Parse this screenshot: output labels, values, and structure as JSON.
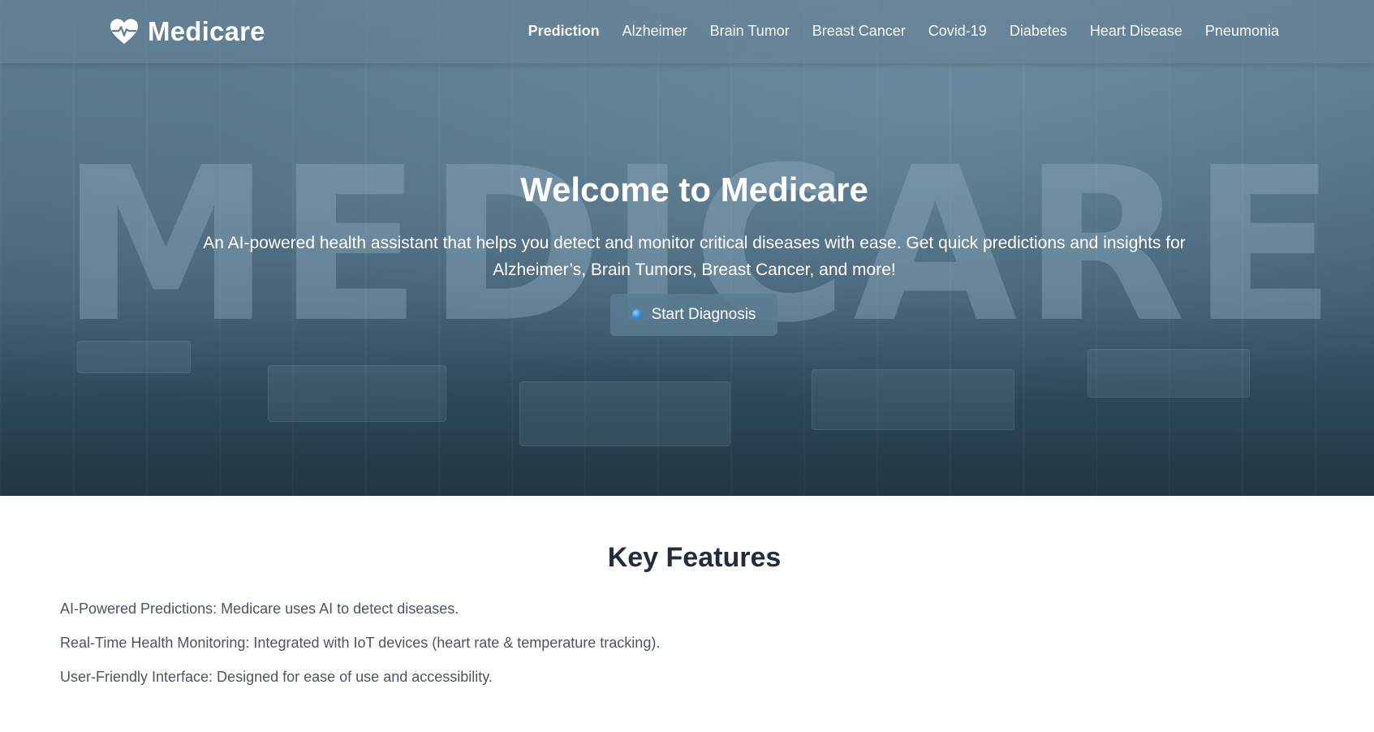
{
  "brand": {
    "name": "Medicare",
    "icon": "heart-pulse-icon"
  },
  "nav": {
    "items": [
      {
        "label": "Prediction",
        "active": true
      },
      {
        "label": "Alzheimer",
        "active": false
      },
      {
        "label": "Brain Tumor",
        "active": false
      },
      {
        "label": "Breast Cancer",
        "active": false
      },
      {
        "label": "Covid-19",
        "active": false
      },
      {
        "label": "Diabetes",
        "active": false
      },
      {
        "label": "Heart Disease",
        "active": false
      },
      {
        "label": "Pneumonia",
        "active": false
      }
    ]
  },
  "hero": {
    "watermark": "MEDICARE",
    "title": "Welcome to Medicare",
    "subtitle": "An AI-powered health assistant that helps you detect and monitor critical diseases with ease. Get quick predictions and insights for Alzheimer’s, Brain Tumors, Breast Cancer, and more!",
    "cta_label": "Start Diagnosis",
    "cta_icon": "blue-circle-icon"
  },
  "features": {
    "title": "Key Features",
    "items": [
      "AI-Powered Predictions: Medicare uses AI to detect diseases.",
      "Real-Time Health Monitoring: Integrated with IoT devices (heart rate & temperature tracking).",
      "User-Friendly Interface: Designed for ease of use and accessibility."
    ]
  },
  "colors": {
    "hero_overlay": "#4d6c80",
    "heading_dark": "#1f2d3d",
    "body_text": "#4b5563",
    "accent_blue": "#2d8ee8"
  }
}
